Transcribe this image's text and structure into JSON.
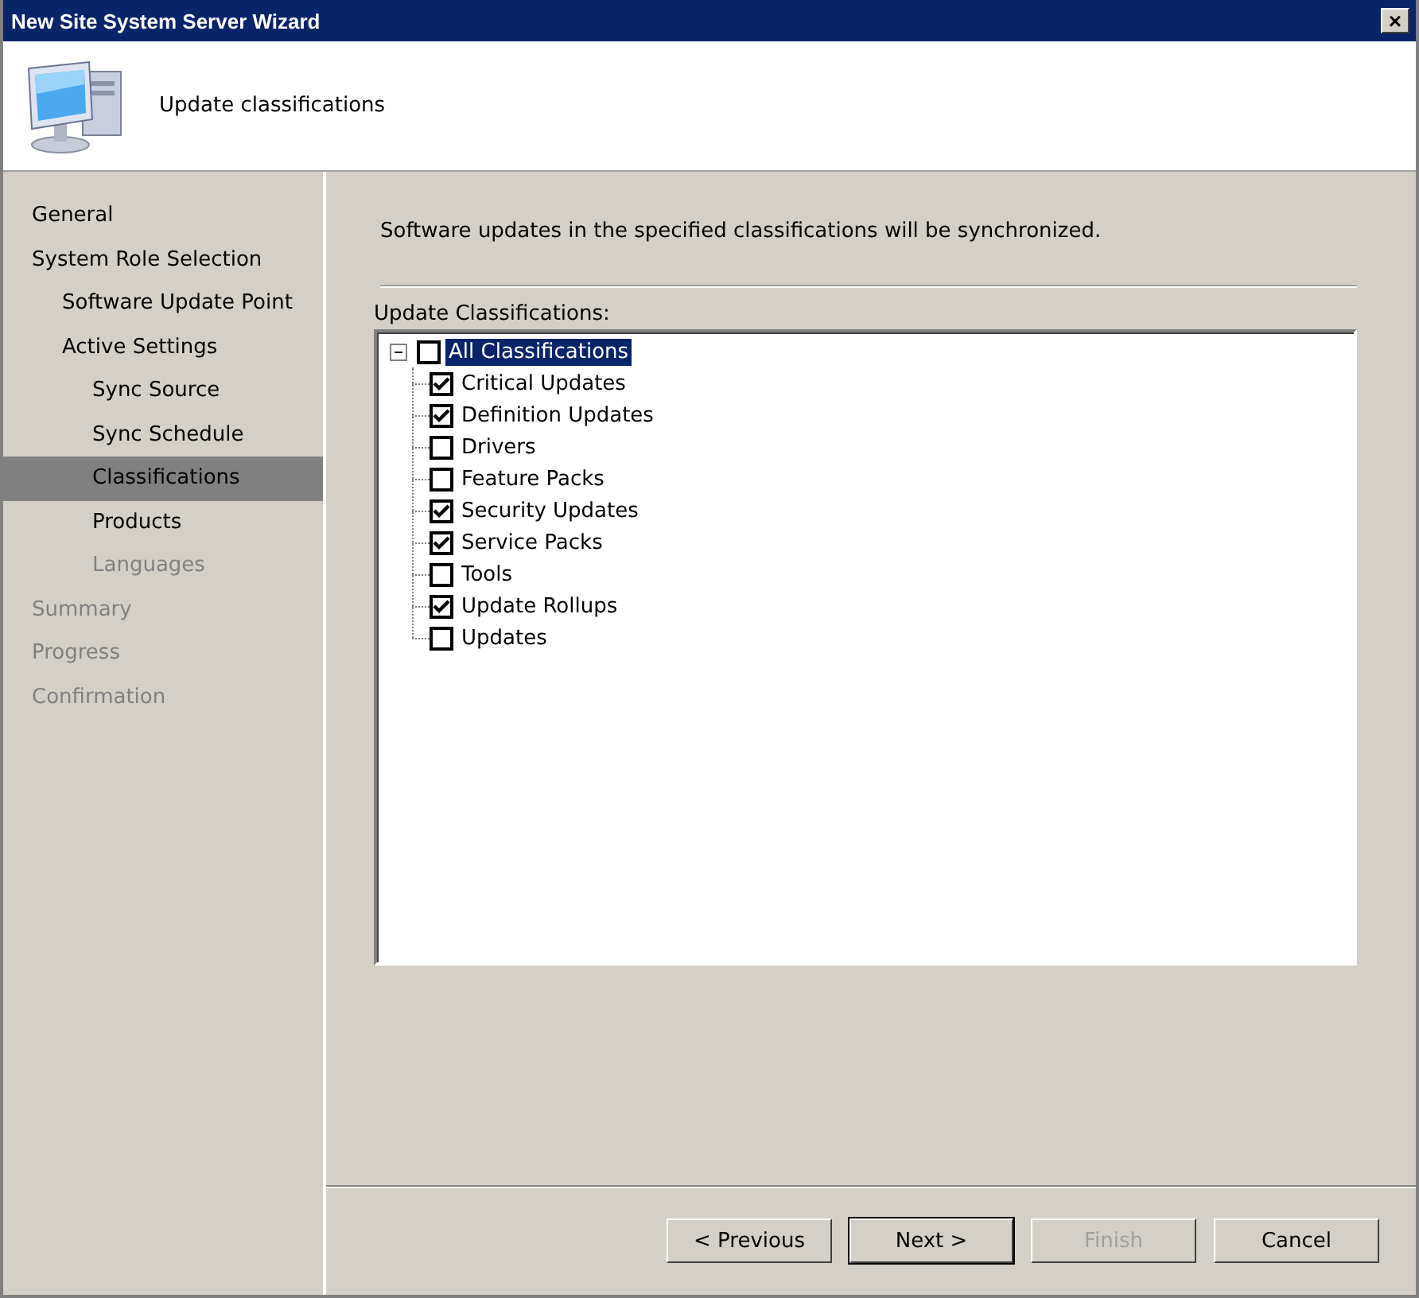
{
  "window": {
    "title": "New Site System Server Wizard",
    "close_glyph": "×"
  },
  "header": {
    "title": "Update classifications"
  },
  "nav": [
    {
      "label": "General",
      "selected": false,
      "disabled": false
    },
    {
      "label": "System Role Selection",
      "selected": false,
      "disabled": false,
      "children": [
        {
          "label": "Software Update Point",
          "selected": false,
          "disabled": false
        },
        {
          "label": "Active Settings",
          "selected": false,
          "disabled": false,
          "children": [
            {
              "label": "Sync Source",
              "selected": false,
              "disabled": false
            },
            {
              "label": "Sync Schedule",
              "selected": false,
              "disabled": false
            },
            {
              "label": "Classifications",
              "selected": true,
              "disabled": false
            },
            {
              "label": "Products",
              "selected": false,
              "disabled": false
            },
            {
              "label": "Languages",
              "selected": false,
              "disabled": true
            }
          ]
        }
      ]
    },
    {
      "label": "Summary",
      "selected": false,
      "disabled": true
    },
    {
      "label": "Progress",
      "selected": false,
      "disabled": true
    },
    {
      "label": "Confirmation",
      "selected": false,
      "disabled": true
    }
  ],
  "description": "Software updates in the specified classifications will be synchronized.",
  "tree_label": {
    "text": "Update Classifications:"
  },
  "tree": [
    {
      "label": "All Classifications",
      "checked": false,
      "selected": true,
      "expanded": true,
      "children": [
        {
          "label": "Critical Updates",
          "checked": true,
          "selected": false
        },
        {
          "label": "Definition Updates",
          "checked": true,
          "selected": false
        },
        {
          "label": "Drivers",
          "checked": false,
          "selected": false
        },
        {
          "label": "Feature Packs",
          "checked": false,
          "selected": false
        },
        {
          "label": "Security Updates",
          "checked": true,
          "selected": false
        },
        {
          "label": "Service Packs",
          "checked": true,
          "selected": false
        },
        {
          "label": "Tools",
          "checked": false,
          "selected": false
        },
        {
          "label": "Update Rollups",
          "checked": true,
          "selected": false
        },
        {
          "label": "Updates",
          "checked": false,
          "selected": false
        }
      ]
    }
  ],
  "buttons": [
    {
      "label": "< Previous",
      "default": false,
      "disabled": false
    },
    {
      "label": "Next >",
      "default": true,
      "disabled": false
    },
    {
      "label": "Finish",
      "default": false,
      "disabled": true
    },
    {
      "label": "Cancel",
      "default": false,
      "disabled": false
    }
  ]
}
